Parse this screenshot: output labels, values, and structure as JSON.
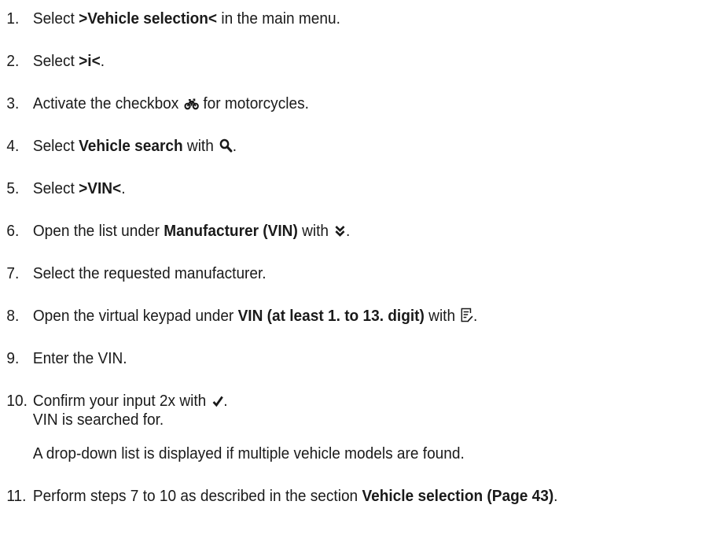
{
  "steps": [
    {
      "num": "1.",
      "pre": "Select ",
      "bold": ">Vehicle selection<",
      "post": " in the main menu."
    },
    {
      "num": "2.",
      "pre": "Select ",
      "bold": ">i<",
      "post": "."
    },
    {
      "num": "3.",
      "pre": "Activate the checkbox ",
      "icon": "motorcycle-icon",
      "post": " for motorcycles."
    },
    {
      "num": "4.",
      "pre": "Select ",
      "bold": "Vehicle search",
      "mid": " with ",
      "icon": "magnifier-icon",
      "post": "."
    },
    {
      "num": "5.",
      "pre": "Select ",
      "bold": ">VIN<",
      "post": "."
    },
    {
      "num": "6.",
      "pre": "Open the list under ",
      "bold": "Manufacturer (VIN)",
      "mid": " with ",
      "icon": "double-chevron-down-icon",
      "post": "."
    },
    {
      "num": "7.",
      "pre": "Select the requested manufacturer."
    },
    {
      "num": "8.",
      "pre": "Open the virtual keypad under ",
      "bold": "VIN (at least 1. to 13. digit)",
      "mid": " with ",
      "icon": "edit-document-icon",
      "post": "."
    },
    {
      "num": "9.",
      "pre": "Enter the VIN."
    },
    {
      "num": "10.",
      "pre": "Confirm your input 2x with ",
      "icon": "checkmark-icon",
      "post": ".",
      "line2": "VIN is searched for.",
      "note": "A drop-down list is displayed if multiple vehicle models are found."
    },
    {
      "num": "11.",
      "pre": "Perform steps 7 to 10 as described in the section ",
      "bold": "Vehicle selection (Page 43)",
      "post": "."
    }
  ]
}
